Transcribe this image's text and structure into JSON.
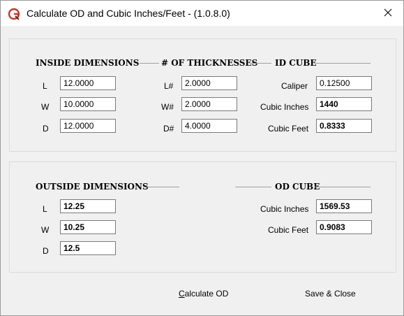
{
  "window": {
    "title": "Calculate OD and Cubic Inches/Feet - (1.0.8.0)",
    "app_icon": "app-logo-icon",
    "close_icon": "close-icon"
  },
  "inside": {
    "header": "INSIDE DIMENSIONS",
    "fields": [
      {
        "label": "L",
        "value": "12.0000"
      },
      {
        "label": "W",
        "value": "10.0000"
      },
      {
        "label": "D",
        "value": "12.0000"
      }
    ]
  },
  "thickness": {
    "header": "# OF THICKNESSES",
    "fields": [
      {
        "label": "L#",
        "value": "2.0000"
      },
      {
        "label": "W#",
        "value": "2.0000"
      },
      {
        "label": "D#",
        "value": "4.0000"
      }
    ]
  },
  "id_cube": {
    "header": "ID CUBE",
    "caliper_label": "Caliper",
    "caliper_value": "0.12500",
    "cubic_inches_label": "Cubic Inches",
    "cubic_inches_value": "1440",
    "cubic_feet_label": "Cubic Feet",
    "cubic_feet_value": "0.8333"
  },
  "outside": {
    "header": "OUTSIDE DIMENSIONS",
    "fields": [
      {
        "label": "L",
        "value": "12.25"
      },
      {
        "label": "W",
        "value": "10.25"
      },
      {
        "label": "D",
        "value": "12.5"
      }
    ]
  },
  "od_cube": {
    "header": "OD CUBE",
    "cubic_inches_label": "Cubic Inches",
    "cubic_inches_value": "1569.53",
    "cubic_feet_label": "Cubic Feet",
    "cubic_feet_value": "0.9083"
  },
  "buttons": {
    "calculate_first": "C",
    "calculate_rest": "alculate OD",
    "save_close": "Save & Close"
  },
  "colors": {
    "icon_red": "#c0392b"
  }
}
